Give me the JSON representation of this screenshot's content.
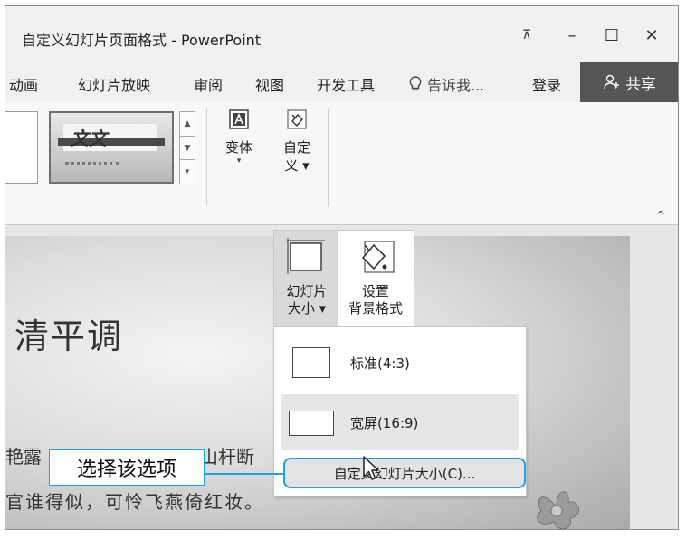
{
  "window": {
    "title": "自定义幻灯片页面格式 - PowerPoint",
    "restore_glyph": "⊼",
    "minimize_glyph": "–",
    "maximize_glyph": "☐",
    "close_glyph": "✕"
  },
  "tabs": [
    {
      "label": "动画"
    },
    {
      "label": "幻灯片放映"
    },
    {
      "label": "审阅"
    },
    {
      "label": "视图"
    },
    {
      "label": "开发工具"
    }
  ],
  "tellme": {
    "label": "告诉我..."
  },
  "signin": {
    "label": "登录"
  },
  "share": {
    "label": "共享"
  },
  "ribbon": {
    "theme_preview_text": "文文",
    "variant_label": "变体",
    "variant_caret": "▾",
    "customize_label_line1": "自定",
    "customize_label_line2": "义 ▾",
    "collapse_glyph": "^",
    "scroll_up": "▲",
    "scroll_down": "▼",
    "scroll_more": "▾"
  },
  "slide": {
    "title": "清平调",
    "line1_left": "艳露",
    "line1_right": "山杆断",
    "line2": "官谁得似，可怜飞燕倚红妆。"
  },
  "slide_size_menu": {
    "button_line1": "幻灯片",
    "button_line2": "大小 ▾",
    "bg_line1": "设置",
    "bg_line2": "背景格式",
    "options": [
      {
        "label": "标准(4:3)"
      },
      {
        "label": "宽屏(16:9)"
      }
    ],
    "custom_label": "自定义幻灯片大小(C)..."
  },
  "callout": {
    "label": "选择该选项"
  },
  "colors": {
    "accent": "#1aa3e6",
    "share_bg": "#555555"
  }
}
